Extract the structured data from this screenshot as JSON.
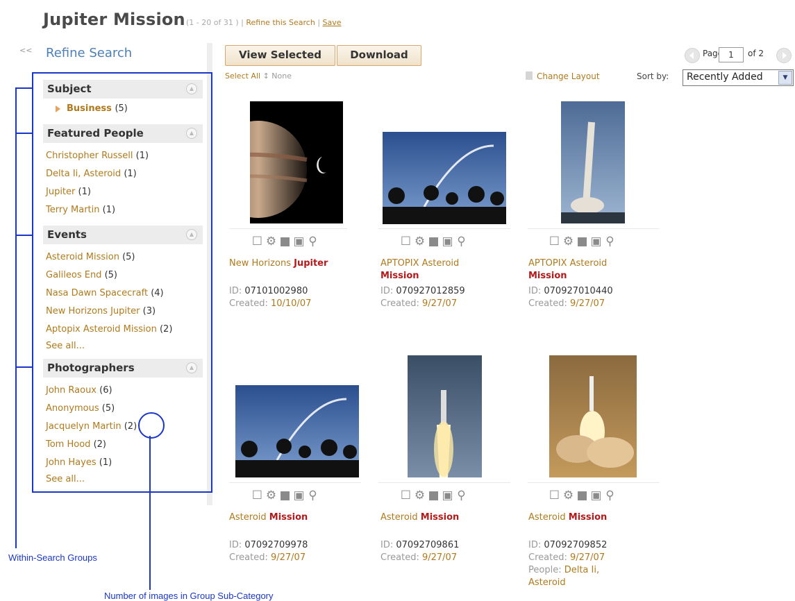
{
  "header": {
    "title": "Jupiter Mission",
    "range": "(1 - 20 of 31 )",
    "pipe": "|",
    "refine_link": "Refine this Search",
    "save_link": "Save"
  },
  "sidebar": {
    "collapse": "<<",
    "title": "Refine Search",
    "groups": [
      {
        "title": "Subject",
        "items": [
          {
            "label": "Business",
            "count": "(5)"
          }
        ]
      },
      {
        "title": "Featured People",
        "items": [
          {
            "label": "Christopher Russell",
            "count": "(1)"
          },
          {
            "label": "Delta Ii, Asteroid",
            "count": "(1)"
          },
          {
            "label": "Jupiter",
            "count": "(1)"
          },
          {
            "label": "Terry Martin",
            "count": "(1)"
          }
        ]
      },
      {
        "title": "Events",
        "items": [
          {
            "label": "Asteroid Mission",
            "count": "(5)"
          },
          {
            "label": "Galileos End",
            "count": "(5)"
          },
          {
            "label": "Nasa Dawn Spacecraft",
            "count": "(4)"
          },
          {
            "label": "New Horizons Jupiter",
            "count": "(3)"
          },
          {
            "label": "Aptopix Asteroid Mission",
            "count": "(2)"
          }
        ],
        "see_all": "See all..."
      },
      {
        "title": "Photographers",
        "items": [
          {
            "label": "John Raoux",
            "count": "(6)"
          },
          {
            "label": "Anonymous",
            "count": "(5)"
          },
          {
            "label": "Jacquelyn Martin",
            "count": "(2)"
          },
          {
            "label": "Tom Hood",
            "count": "(2)"
          },
          {
            "label": "John Hayes",
            "count": "(1)"
          }
        ],
        "see_all": "See all..."
      }
    ]
  },
  "annotations": {
    "groups_label": "Within-Search Groups",
    "count_label": "Number of images in Group Sub-Category"
  },
  "toolbar": {
    "view_selected": "View Selected",
    "download": "Download",
    "select_all": "Select All",
    "none": "None",
    "page_label": "Page",
    "page_value": "1",
    "page_of": "of 2",
    "change_layout": "Change Layout",
    "sort_by": "Sort by:",
    "sort_value": "Recently Added"
  },
  "results": [
    {
      "caption": "New Horizons",
      "caption_bold": "Jupiter",
      "id_label": "ID:",
      "id": "07101002980",
      "created_label": "Created:",
      "created": "10/10/07"
    },
    {
      "caption": "APTOPIX Asteroid",
      "caption_bold": "Mission",
      "id_label": "ID:",
      "id": "070927012859",
      "created_label": "Created:",
      "created": "9/27/07"
    },
    {
      "caption": "APTOPIX Asteroid",
      "caption_bold": "Mission",
      "id_label": "ID:",
      "id": "070927010440",
      "created_label": "Created:",
      "created": "9/27/07"
    },
    {
      "caption": "Asteroid",
      "caption_bold": "Mission",
      "id_label": "ID:",
      "id": "07092709978",
      "created_label": "Created:",
      "created": "9/27/07"
    },
    {
      "caption": "Asteroid",
      "caption_bold": "Mission",
      "id_label": "ID:",
      "id": "07092709861",
      "created_label": "Created:",
      "created": "9/27/07"
    },
    {
      "caption": "Asteroid",
      "caption_bold": "Mission",
      "id_label": "ID:",
      "id": "07092709852",
      "created_label": "Created:",
      "created": "9/27/07",
      "people_label": "People:",
      "people": "Delta Ii, Asteroid"
    }
  ],
  "result_icons": [
    "checkbox-icon",
    "gear-icon",
    "download-icon",
    "save-icon",
    "zoom-icon"
  ],
  "colors": {
    "accent": "#b07a1c",
    "link_blue": "#4d7fb7",
    "highlight_red": "#b41a1a",
    "annotation": "#1a36c8"
  }
}
